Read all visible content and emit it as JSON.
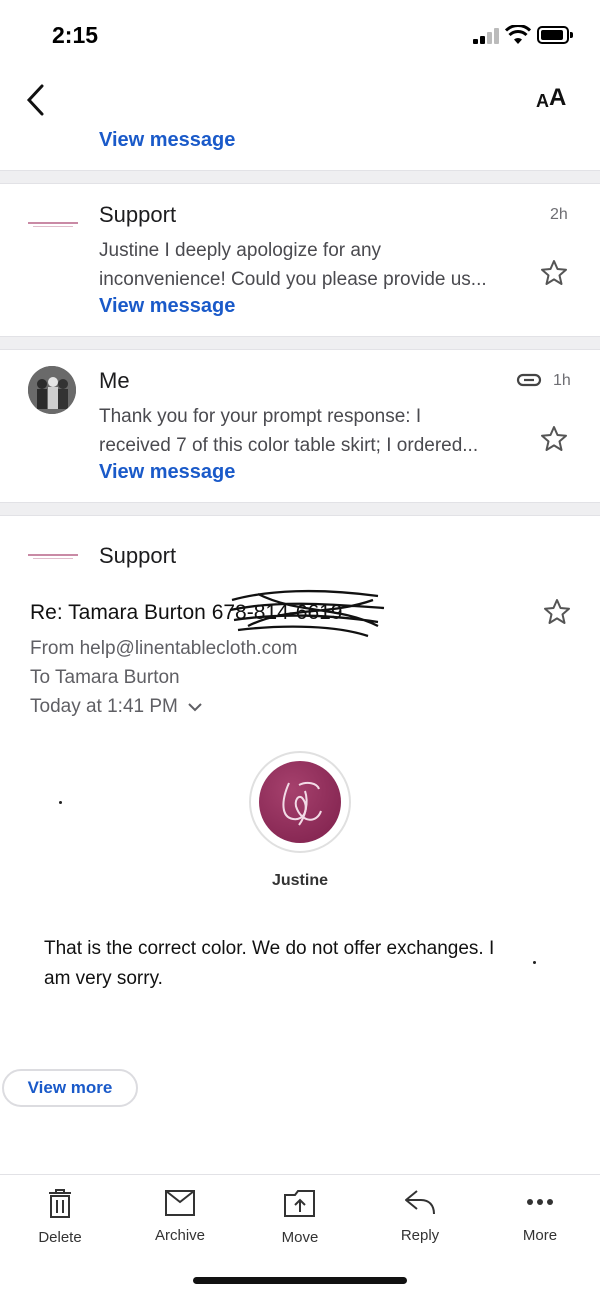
{
  "status_bar": {
    "time": "2:15"
  },
  "nav": {
    "font_size_label_small": "A",
    "font_size_label_large": "A"
  },
  "thread": [
    {
      "view_label": "View message"
    },
    {
      "sender": "Support",
      "time": "2h",
      "snippet_lines": [
        "Justine I deeply apologize for any",
        "inconvenience! Could you please provide us..."
      ],
      "view_label": "View message"
    },
    {
      "sender": "Me",
      "time": "1h",
      "has_attachment": true,
      "snippet_lines": [
        "Thank you for your prompt response: I",
        "received 7 of this color table skirt; I ordered..."
      ],
      "view_label": "View message"
    }
  ],
  "open_message": {
    "sender": "Support",
    "subject": "Re: Tamara Burton 678",
    "subject_redacted_part": "-814-6619",
    "from_line": "From help@linentablecloth.com",
    "to_line": "To Tamara Burton",
    "date_line": "Today at 1:41 PM",
    "signature_name": "Justine",
    "body_lines": [
      "That is the correct color. We do not offer exchanges. I",
      "am very sorry."
    ],
    "view_more_label": "View more"
  },
  "toolbar": {
    "items": [
      {
        "label": "Delete",
        "icon": "trash-icon"
      },
      {
        "label": "Archive",
        "icon": "archive-icon"
      },
      {
        "label": "Move",
        "icon": "move-icon"
      },
      {
        "label": "Reply",
        "icon": "reply-icon"
      },
      {
        "label": "More",
        "icon": "more-icon"
      }
    ]
  },
  "colors": {
    "link": "#1a5ac9",
    "logo_accent": "#8b2351"
  }
}
